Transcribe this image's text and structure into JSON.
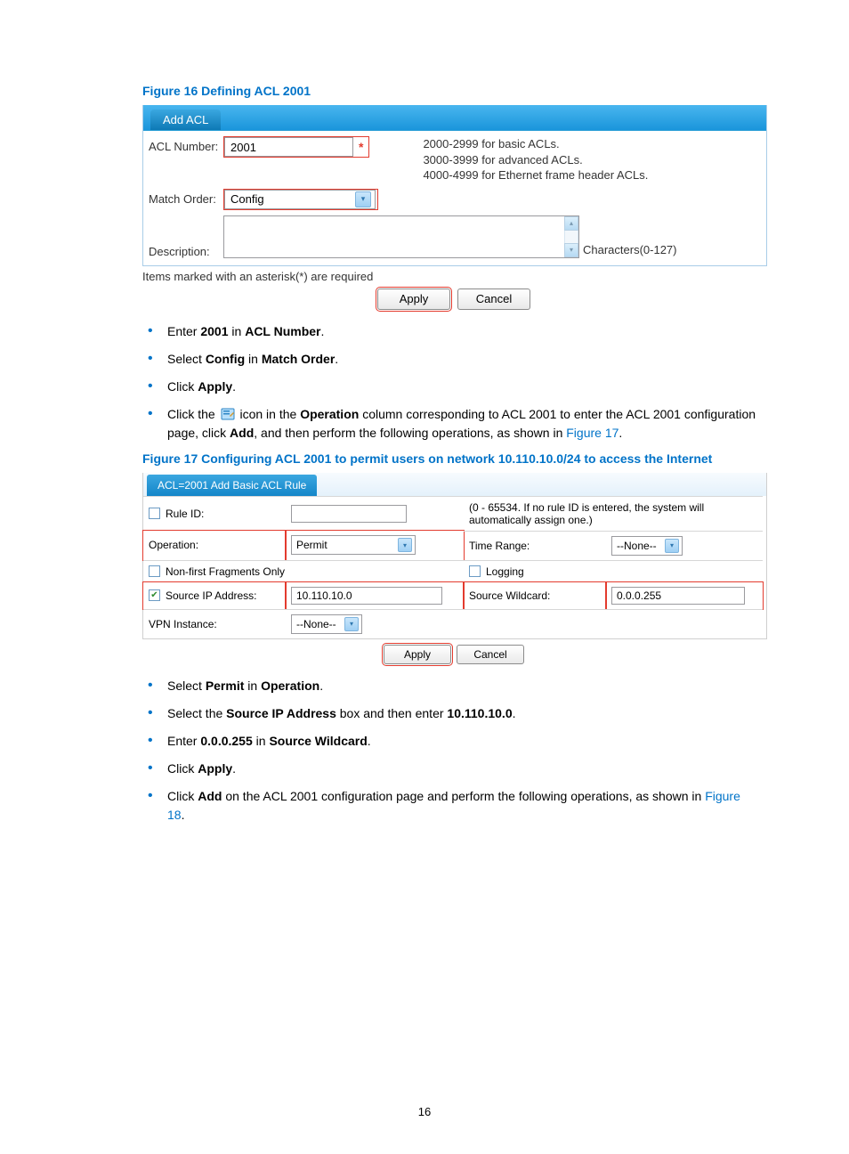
{
  "fig16": {
    "caption": "Figure 16 Defining ACL 2001",
    "tab": "Add ACL",
    "labels": {
      "acl_number": "ACL Number:",
      "match_order": "Match Order:",
      "description": "Description:"
    },
    "acl_number_value": "2001",
    "match_order_value": "Config",
    "hint_line1": "2000-2999 for basic ACLs.",
    "hint_line2": "3000-3999 for advanced ACLs.",
    "hint_line3": "4000-4999 for Ethernet frame header ACLs.",
    "char_hint": "Characters(0-127)",
    "required_note": "Items marked with an asterisk(*) are required",
    "apply": "Apply",
    "cancel": "Cancel"
  },
  "steps16": {
    "s1a": "Enter ",
    "s1b": "2001",
    "s1c": " in ",
    "s1d": "ACL Number",
    "s1e": ".",
    "s2a": "Select ",
    "s2b": "Config",
    "s2c": " in ",
    "s2d": "Match Order",
    "s2e": ".",
    "s3a": "Click ",
    "s3b": "Apply",
    "s3c": ".",
    "s4a": "Click the ",
    "s4b": " icon in the ",
    "s4c": "Operation",
    "s4d": " column corresponding to ACL 2001 to enter the ACL 2001 configuration page, click ",
    "s4e": "Add",
    "s4f": ", and then perform the following operations, as shown in ",
    "s4g": "Figure 17",
    "s4h": "."
  },
  "fig17": {
    "caption": "Figure 17 Configuring ACL 2001 to permit users on network 10.110.10.0/24 to access the Internet",
    "tab": "ACL=2001 Add Basic ACL Rule",
    "labels": {
      "rule_id": "Rule ID:",
      "operation": "Operation:",
      "time_range": "Time Range:",
      "nonfirst": "Non-first Fragments Only",
      "logging": "Logging",
      "src_ip": "Source IP Address:",
      "src_wc": "Source Wildcard:",
      "vpn": "VPN Instance:"
    },
    "rule_hint": "(0 - 65534. If no rule ID is entered, the system will automatically assign one.)",
    "operation_value": "Permit",
    "time_range_value": "--None--",
    "src_ip_value": "10.110.10.0",
    "src_wc_value": "0.0.0.255",
    "vpn_value": "--None--",
    "apply": "Apply",
    "cancel": "Cancel"
  },
  "steps17": {
    "s1a": "Select ",
    "s1b": "Permit",
    "s1c": " in ",
    "s1d": "Operation",
    "s1e": ".",
    "s2a": "Select the ",
    "s2b": "Source IP Address",
    "s2c": " box and then enter ",
    "s2d": "10.110.10.0",
    "s2e": ".",
    "s3a": "Enter ",
    "s3b": "0.0.0.255",
    "s3c": " in ",
    "s3d": "Source Wildcard",
    "s3e": ".",
    "s4a": "Click ",
    "s4b": "Apply",
    "s4c": ".",
    "s5a": "Click ",
    "s5b": "Add",
    "s5c": " on the ACL 2001 configuration page and perform the following operations, as shown in ",
    "s5d": "Figure 18",
    "s5e": "."
  },
  "page_number": "16"
}
